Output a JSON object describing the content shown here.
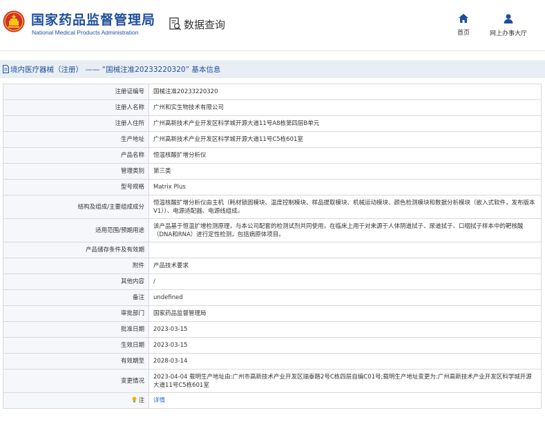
{
  "header": {
    "brand_cn": "国家药品监督管理局",
    "brand_en": "National Medical Products Administration",
    "query_title": "数据查询",
    "nav": [
      {
        "label": "首页",
        "icon": "home-icon"
      },
      {
        "label": "网上办事大厅",
        "icon": "user-icon"
      }
    ],
    "colors": {
      "brand": "#1f4e9c",
      "emblem_red": "#d32f2f",
      "emblem_gold": "#f5c518"
    }
  },
  "breadcrumb": {
    "text": "境内医疗器械（注册） ——  “国械注准20233220320” 基本信息",
    "icon": "document-icon"
  },
  "table": {
    "rows": [
      {
        "label": "注册证编号",
        "value": "国械注准20233220320"
      },
      {
        "label": "注册人名称",
        "value": "广州和实生物技术有限公司"
      },
      {
        "label": "注册人住所",
        "value": "广州高新技术产业开发区科学城开源大道11号A8栋第四层B单元"
      },
      {
        "label": "生产地址",
        "value": "广州高新技术产业开发区科学城开源大道11号C5栋601室"
      },
      {
        "label": "产品名称",
        "value": "恒温核酸扩增分析仪"
      },
      {
        "label": "管理类别",
        "value": "第三类"
      },
      {
        "label": "型号规格",
        "value": "Matrix Plus"
      },
      {
        "label": "结构及组成/主要组成成分",
        "value": "恒温核酸扩增分析仪由主机（耗材锁固模块、温度控制模块、样品提取模块、机械运动模块、颜色检测模块和数据分析模块（嵌入式软件，发布版本V1））、电源适配器、电源线组成。"
      },
      {
        "label": "适用范围/预期用途",
        "value": "该产品基于恒温扩增检测原理，与本公司配套的检测试剂共同使用，在临床上用于对来源于人体阴道拭子、尿道拭子、口咽拭子样本中的靶核酸（DNA和RNA）进行定性检测，包括病原体项目。"
      },
      {
        "label": "产品储存条件及有效期",
        "value": ""
      },
      {
        "label": "附件",
        "value": "产品技术要求"
      },
      {
        "label": "其他内容",
        "value": "/"
      },
      {
        "label": "备注",
        "value": "undefined"
      },
      {
        "label": "审批部门",
        "value": "国家药品监督管理局"
      },
      {
        "label": "批准日期",
        "value": "2023-03-15"
      },
      {
        "label": "生效日期",
        "value": "2023-03-15"
      },
      {
        "label": "有效期至",
        "value": "2028-03-14"
      },
      {
        "label": "变更情况",
        "value": "2023-04-04 载明生产地址由:广州市高新技术产业开发区瑞泰路2号C栋四层自编C01号;载明生产地址变更为:广州高新技术产业开发区科学城开源大道11号C5栋601室"
      }
    ],
    "note": {
      "label": "注",
      "icon": "lightbulb-icon",
      "link": "详情"
    }
  }
}
